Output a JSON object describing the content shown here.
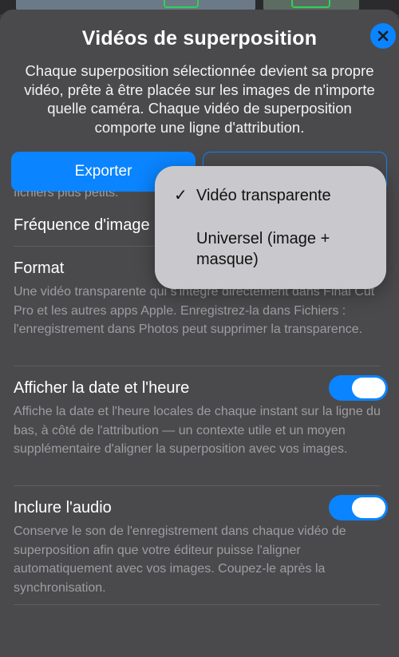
{
  "sheet": {
    "title": "Vidéos de superposition",
    "intro": "Chaque superposition sélectionnée devient sa propre vidéo, prête à être placée sur les images de n'importe quelle caméra. Chaque vidéo de superposition comporte une ligne d'attribution.",
    "close_icon": "close-x-icon"
  },
  "buttons": {
    "export_label": "Exporter",
    "secondary_label": ""
  },
  "clipped_text": "fichiers plus petits.",
  "settings": {
    "frame_rate_label": "Fréquence d'image",
    "format_label": "Format",
    "format_desc": "Une vidéo transparente qui s'intègre directement dans Final Cut Pro et les autres apps Apple. Enregistrez-la dans Fichiers : l'enregistrement dans Photos peut supprimer la transparence.",
    "datetime_label": "Afficher la date et l'heure",
    "datetime_desc": "Affiche la date et l'heure locales de chaque instant sur la ligne du bas, à côté de l'attribution — un contexte utile et un moyen supplémentaire d'aligner la superposition avec vos images.",
    "datetime_on": true,
    "audio_label": "Inclure l'audio",
    "audio_desc": "Conserve le son de l'enregistrement dans chaque vidéo de superposition afin que votre éditeur puisse l'aligner automatiquement avec vos images. Coupez-le après la synchronisation.",
    "audio_on": true
  },
  "menu": {
    "selected_check": "✓",
    "items": [
      {
        "label": "Vidéo transparente",
        "selected": true
      },
      {
        "label": "Universel (image + masque)",
        "selected": false
      }
    ]
  },
  "colors": {
    "accent": "#0a84ff",
    "sheet_bg": "#4a4a4c",
    "menu_bg": "#c9c9cd"
  }
}
